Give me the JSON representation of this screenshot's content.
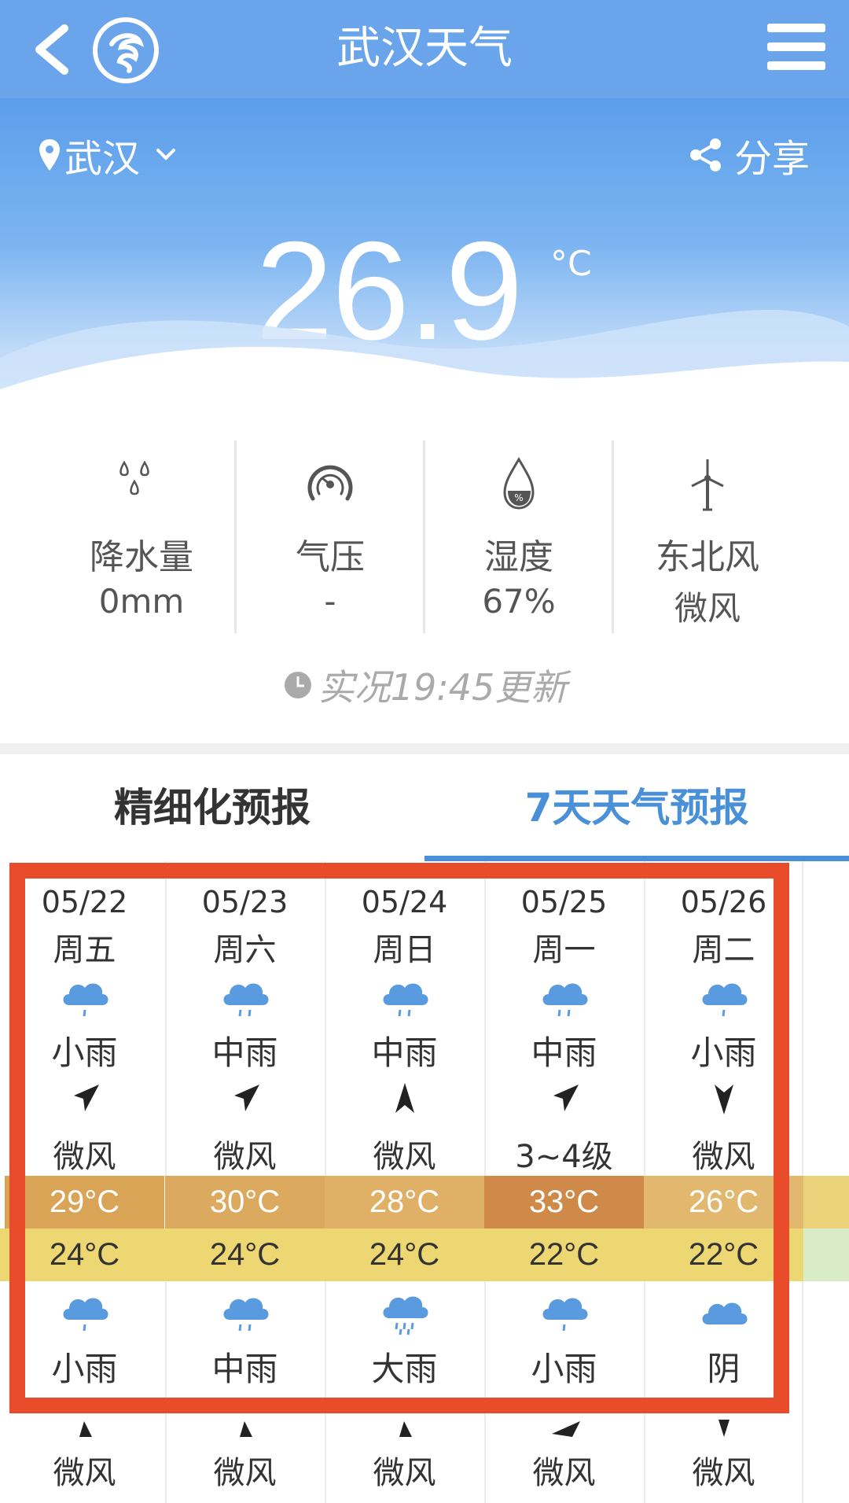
{
  "header": {
    "title": "武汉天气"
  },
  "location": {
    "city": "武汉"
  },
  "share": {
    "label": "分享"
  },
  "current": {
    "temperature": "26.9",
    "unit": "°C"
  },
  "stats": [
    {
      "icon": "raindrops-icon",
      "label": "降水量",
      "value": "0mm"
    },
    {
      "icon": "pressure-gauge-icon",
      "label": "气压",
      "value": "-"
    },
    {
      "icon": "humidity-drop-icon",
      "label": "湿度",
      "value": "67%"
    },
    {
      "icon": "wind-turbine-icon",
      "label": "东北风",
      "value": "微风"
    }
  ],
  "updated": "实况19:45更新",
  "tabs": [
    {
      "label": "精细化预报",
      "active": false
    },
    {
      "label": "7天天气预报",
      "active": true
    }
  ],
  "forecast": [
    {
      "date": "05/22",
      "weekday": "周五",
      "day_condition": "小雨",
      "day_wind": "微风",
      "wind_dir": "northeast",
      "high": "29°C",
      "high_color": "#d9a456",
      "low": "24°C",
      "night_condition": "小雨",
      "night_wind": "微风"
    },
    {
      "date": "05/23",
      "weekday": "周六",
      "day_condition": "中雨",
      "day_wind": "微风",
      "wind_dir": "northeast",
      "high": "30°C",
      "high_color": "#dcaa5e",
      "low": "24°C",
      "night_condition": "中雨",
      "night_wind": "微风"
    },
    {
      "date": "05/24",
      "weekday": "周日",
      "day_condition": "中雨",
      "day_wind": "微风",
      "wind_dir": "north",
      "high": "28°C",
      "high_color": "#dfb066",
      "low": "24°C",
      "night_condition": "大雨",
      "night_wind": "微风"
    },
    {
      "date": "05/25",
      "weekday": "周一",
      "day_condition": "中雨",
      "day_wind": "3~4级",
      "wind_dir": "northeast",
      "high": "33°C",
      "high_color": "#cf8a4a",
      "low": "22°C",
      "night_condition": "小雨",
      "night_wind": "微风"
    },
    {
      "date": "05/26",
      "weekday": "周二",
      "day_condition": "小雨",
      "day_wind": "微风",
      "wind_dir": "south",
      "high": "26°C",
      "high_color": "#e1b86e",
      "low": "22°C",
      "night_condition": "阴",
      "night_wind": "微风"
    }
  ],
  "colors": {
    "nav": "#6aa5ec",
    "accent": "#4a90d9",
    "highlight_border": "#e84c2b",
    "low_band": "#ecd773"
  }
}
